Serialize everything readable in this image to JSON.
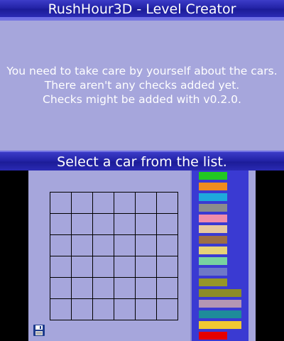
{
  "header": {
    "title": "RushHour3D - Level Creator"
  },
  "message": {
    "lines": [
      "You need to take care by yourself about the cars.",
      "There aren't any checks added yet.",
      "Checks might be added with v0.2.0."
    ]
  },
  "instruction": {
    "text": "Select a car from the list."
  },
  "board": {
    "rows": 6,
    "cols": 6
  },
  "toolbar": {
    "save_icon": "floppy-disk-icon"
  },
  "car_list": {
    "cars": [
      {
        "color": "#22c822",
        "length": 2
      },
      {
        "color": "#f08c1e",
        "length": 2
      },
      {
        "color": "#1eaadc",
        "length": 2
      },
      {
        "color": "#8c8c8c",
        "length": 2
      },
      {
        "color": "#f08caa",
        "length": 2
      },
      {
        "color": "#e6c8a0",
        "length": 2
      },
      {
        "color": "#9c6e46",
        "length": 2
      },
      {
        "color": "#e6d278",
        "length": 2
      },
      {
        "color": "#78d2a0",
        "length": 2
      },
      {
        "color": "#6e78c8",
        "length": 2
      },
      {
        "color": "#969628",
        "length": 2
      },
      {
        "color": "#8c8c28",
        "length": 3
      },
      {
        "color": "#b496b4",
        "length": 3
      },
      {
        "color": "#1e8c9a",
        "length": 3
      },
      {
        "color": "#f0c832",
        "length": 3
      },
      {
        "color": "#e60000",
        "length": 2
      }
    ]
  }
}
